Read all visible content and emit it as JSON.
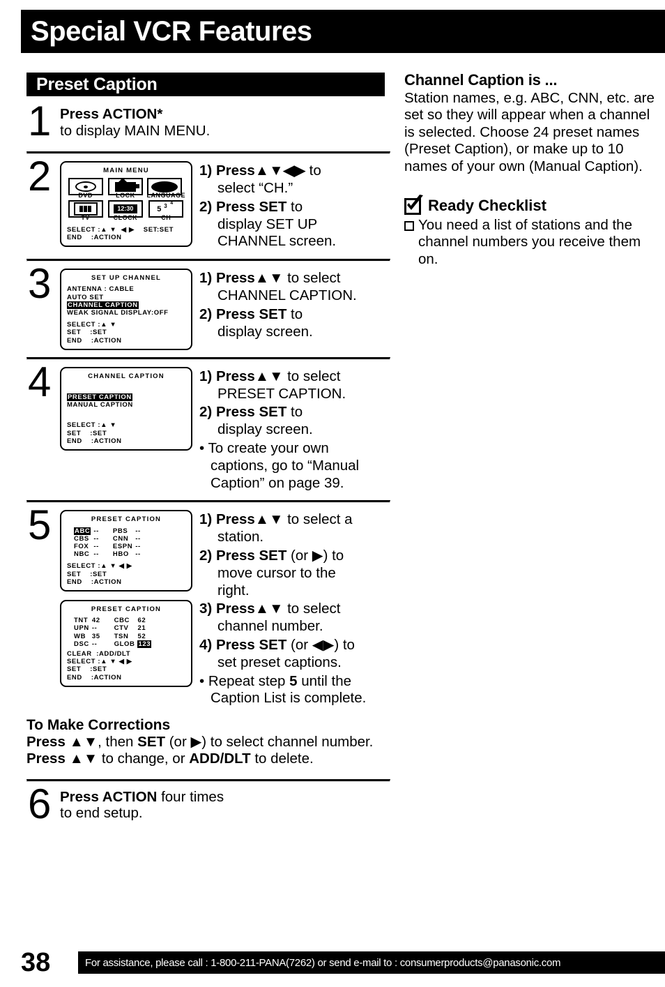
{
  "page": {
    "title": "Special VCR Features",
    "number": "38",
    "footer_note": "For assistance, please call : 1-800-211-PANA(7262) or send e-mail to : consumerproducts@panasonic.com"
  },
  "section": {
    "heading": "Preset Caption"
  },
  "steps": [
    {
      "num": "1",
      "line1_bold": "Press ACTION*",
      "line2": "to display MAIN MENU."
    },
    {
      "num": "2",
      "instructions": [
        {
          "marker": "1)",
          "bold": "Press",
          "arrows": "▲▼◀▶",
          "rest": " to",
          "cont": "select “CH.”"
        },
        {
          "marker": "2)",
          "bold": "Press SET",
          "rest": " to",
          "cont": "display SET UP",
          "cont2": "CHANNEL screen."
        }
      ],
      "osd": {
        "title": "MAIN MENU",
        "icons": [
          {
            "label": "DVD",
            "icon": "disc-icon"
          },
          {
            "label": "LOCK",
            "icon": "camcorder-icon"
          },
          {
            "label": "LANGUAGE",
            "icon": "mouth-icon"
          },
          {
            "label": "TV",
            "icon": "tv-face-icon"
          },
          {
            "label": "CLOCK",
            "icon": "clock-icon",
            "value": "12:30"
          },
          {
            "label": "CH",
            "icon": "channel-number-icon",
            "value": "5",
            "sup1": "3",
            "sup2": "4"
          }
        ],
        "legend": [
          "SELECT :▲ ▼  ◀ ▶    SET:SET",
          "END    :ACTION"
        ]
      }
    },
    {
      "num": "3",
      "instructions": [
        {
          "marker": "1)",
          "bold": "Press",
          "arrows": "▲▼",
          "rest": " to select",
          "cont": "CHANNEL CAPTION."
        },
        {
          "marker": "2)",
          "bold": "Press SET",
          "rest": " to",
          "cont": "display  screen."
        }
      ],
      "osd": {
        "title": "SET UP CHANNEL",
        "rows": [
          {
            "text": "ANTENNA : CABLE",
            "highlight": false
          },
          {
            "text": "AUTO SET",
            "highlight": false
          },
          {
            "text": "CHANNEL CAPTION",
            "highlight": true
          },
          {
            "text": "WEAK SIGNAL DISPLAY:OFF",
            "highlight": false
          }
        ],
        "legend": [
          "SELECT :▲ ▼",
          "SET    :SET",
          "END    :ACTION"
        ]
      }
    },
    {
      "num": "4",
      "instructions": [
        {
          "marker": "1)",
          "bold": "Press",
          "arrows": "▲▼",
          "rest": " to select",
          "cont": "PRESET CAPTION."
        },
        {
          "marker": "2)",
          "bold": "Press SET",
          "rest": " to",
          "cont": "display screen."
        },
        {
          "marker": "•",
          "plain": "To create your own",
          "cont": "captions, go to “Manual",
          "cont2": "Caption” on page 39."
        }
      ],
      "osd": {
        "title": "CHANNEL CAPTION",
        "rows": [
          {
            "text": "PRESET CAPTION",
            "highlight": true
          },
          {
            "text": "MANUAL CAPTION",
            "highlight": false
          }
        ],
        "legend": [
          "SELECT :▲ ▼",
          "SET    :SET",
          "END    :ACTION"
        ]
      }
    },
    {
      "num": "5",
      "instructions": [
        {
          "marker": "1)",
          "bold": "Press",
          "arrows": "▲▼",
          "rest": " to select a",
          "cont": "station."
        },
        {
          "marker": "2)",
          "bold": "Press SET",
          "rest": " (or ▶) to",
          "cont": "move cursor to the",
          "cont2": "right."
        },
        {
          "marker": "3)",
          "bold": "Press",
          "arrows": "▲▼",
          "rest": " to select",
          "cont": "channel number."
        },
        {
          "marker": "4)",
          "bold": "Press SET",
          "rest": " (or ◀▶) to",
          "cont": "set preset captions."
        },
        {
          "marker": "•",
          "plain_pre": "Repeat step ",
          "plain_bold": "5",
          "plain_post": " until the",
          "cont": "Caption List is complete."
        }
      ],
      "osd_a": {
        "title": "PRESET CAPTION",
        "entries": [
          {
            "name1": "ABC",
            "val1": "--",
            "name1_highlight": true,
            "name2": "PBS",
            "val2": "--"
          },
          {
            "name1": "CBS",
            "val1": "--",
            "name2": "CNN",
            "val2": "--"
          },
          {
            "name1": "FOX",
            "val1": "--",
            "name2": "ESPN",
            "val2": "--"
          },
          {
            "name1": "NBC",
            "val1": "--",
            "name2": "HBO",
            "val2": "--"
          }
        ],
        "legend": [
          "SELECT :▲ ▼ ◀ ▶",
          "SET    :SET",
          "END    :ACTION"
        ]
      },
      "osd_b": {
        "title": "PRESET CAPTION",
        "entries": [
          {
            "name1": "TNT",
            "val1": "42",
            "name2": "CBC",
            "val2": "62"
          },
          {
            "name1": "UPN",
            "val1": "--",
            "name2": "CTV",
            "val2": "21"
          },
          {
            "name1": "WB",
            "val1": "35",
            "name2": "TSN",
            "val2": "52"
          },
          {
            "name1": "DSC",
            "val1": "--",
            "name2": "GLOB",
            "val2": "123",
            "val2_highlight": true
          }
        ],
        "legend": [
          "CLEAR  :ADD/DLT",
          "SELECT :▲ ▼ ◀ ▶",
          "SET    :SET",
          "END    :ACTION"
        ]
      }
    },
    {
      "num": "6",
      "line1_bold": "Press ACTION",
      "line1_rest": " four times",
      "line2": "to end setup."
    }
  ],
  "corrections": {
    "title": "To Make Corrections",
    "line1_a": "Press ",
    "line1_arrows": "▲▼",
    "line1_b": ", then ",
    "line1_bold": "SET",
    "line1_c": " (or ▶) to select channel number.",
    "line2_a": "Press ",
    "line2_arrows": "▲▼",
    "line2_b": " to change, or ",
    "line2_bold": "ADD/DLT",
    "line2_c": " to delete."
  },
  "aside": {
    "heading": "Channel Caption is ...",
    "body": "Station names, e.g. ABC, CNN, etc. are set so they will appear when a channel is selected. Choose 24 preset names (Preset Caption), or make up to 10 names of your own (Manual Caption).",
    "checklist_title": "Ready Checklist",
    "checklist_item": "You need a list of stations and the channel numbers you receive them on."
  }
}
